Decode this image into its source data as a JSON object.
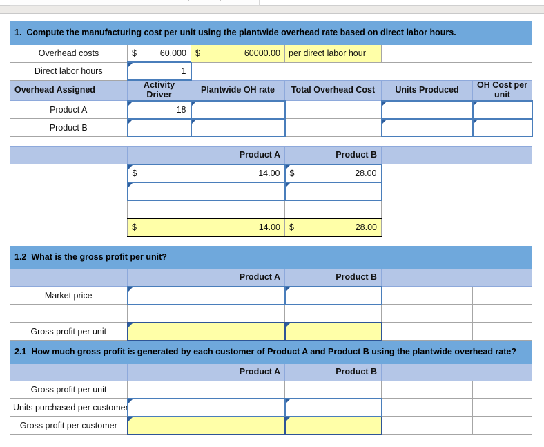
{
  "window": {
    "chrome_glyphs": [
      "|",
      "|",
      "—",
      "—"
    ]
  },
  "sections": {
    "q1": {
      "number": "1.",
      "text": "Compute the manufacturing cost per unit using the plantwide overhead rate based on direct labor hours."
    },
    "q12": {
      "number": "1.2",
      "text": "What is the gross profit per unit?"
    },
    "q21": {
      "number": "2.1",
      "text": "How much gross profit is generated by each customer of Product A and Product B using the plantwide overhead rate?"
    }
  },
  "inputs": {
    "overhead_costs_label": "Overhead costs",
    "overhead_costs_currency": "$",
    "overhead_costs_value": "60,000",
    "plantwide_rate_currency": "$",
    "plantwide_rate_value": "60000.00",
    "plantwide_rate_unit": "per direct labor hour",
    "direct_labor_hours_label": "Direct labor hours",
    "direct_labor_hours_value": "1"
  },
  "overhead_table": {
    "headers": [
      "Overhead Assigned",
      "Activity Driver",
      "Plantwide OH rate",
      "Total Overhead Cost",
      "Units Produced",
      "OH Cost per unit"
    ],
    "rows": [
      {
        "label": "Product A",
        "activity_driver": "18",
        "plantwide_oh_rate": "",
        "total_overhead_cost": "",
        "units_produced": "",
        "oh_cost_per_unit": ""
      },
      {
        "label": "Product B",
        "activity_driver": "",
        "plantwide_oh_rate": "",
        "total_overhead_cost": "",
        "units_produced": "",
        "oh_cost_per_unit": ""
      }
    ]
  },
  "cost_table": {
    "col_a": "Product A",
    "col_b": "Product B",
    "rows": [
      {
        "label": "",
        "a_currency": "$",
        "a_value": "14.00",
        "b_currency": "$",
        "b_value": "28.00"
      },
      {
        "label": "",
        "a_currency": "",
        "a_value": "",
        "b_currency": "",
        "b_value": ""
      },
      {
        "label": "",
        "a_currency": "",
        "a_value": "",
        "b_currency": "",
        "b_value": ""
      }
    ],
    "total": {
      "label": "",
      "a_currency": "$",
      "a_value": "14.00",
      "b_currency": "$",
      "b_value": "28.00"
    }
  },
  "gross_profit_table": {
    "col_a": "Product A",
    "col_b": "Product B",
    "rows": [
      {
        "label": "Market price",
        "a": "",
        "b": ""
      },
      {
        "label": "",
        "a": "",
        "b": ""
      },
      {
        "label": "Gross profit per unit",
        "a": "",
        "b": ""
      }
    ]
  },
  "customer_table": {
    "col_a": "Product A",
    "col_b": "Product B",
    "rows": [
      {
        "label": "Gross profit per unit",
        "a": "",
        "b": ""
      },
      {
        "label": "Units purchased per customer",
        "a": "",
        "b": ""
      },
      {
        "label": "Gross profit per customer",
        "a": "",
        "b": ""
      }
    ]
  },
  "colors": {
    "banner_blue": "#6fa8dc",
    "header_blue": "#b4c6e7",
    "input_border": "#4a7ebb",
    "answer_yellow": "#ffffa8"
  }
}
